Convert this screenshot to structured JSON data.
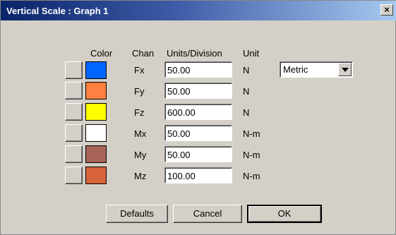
{
  "window": {
    "title": "Vertical Scale : Graph 1",
    "close_glyph": "×"
  },
  "headers": {
    "color": "Color",
    "chan": "Chan",
    "units": "Units/Division",
    "unit": "Unit"
  },
  "rows": [
    {
      "chan": "Fx",
      "units": "50.00",
      "unit": "N",
      "color": "#0066ff"
    },
    {
      "chan": "Fy",
      "units": "50.00",
      "unit": "N",
      "color": "#ff8040"
    },
    {
      "chan": "Fz",
      "units": "600.00",
      "unit": "N",
      "color": "#ffff00"
    },
    {
      "chan": "Mx",
      "units": "50.00",
      "unit": "N-m",
      "color": "#ffffff"
    },
    {
      "chan": "My",
      "units": "50.00",
      "unit": "N-m",
      "color": "#a86458"
    },
    {
      "chan": "Mz",
      "units": "100.00",
      "unit": "N-m",
      "color": "#d8643a"
    }
  ],
  "system_select": {
    "value": "Metric"
  },
  "buttons": {
    "defaults": "Defaults",
    "cancel": "Cancel",
    "ok": "OK"
  }
}
